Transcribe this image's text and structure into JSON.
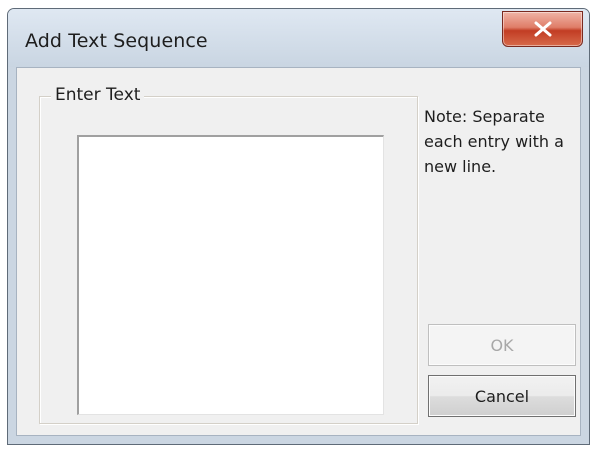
{
  "window": {
    "title": "Add Text Sequence",
    "close_icon": "close-x-icon"
  },
  "group": {
    "label": "Enter Text"
  },
  "text_input": {
    "value": ""
  },
  "note": {
    "text": "Note: Separate each entry with a new line."
  },
  "buttons": {
    "ok_label": "OK",
    "ok_enabled": false,
    "cancel_label": "Cancel"
  },
  "colors": {
    "close_button": "#c8452c",
    "frame": "#cbd6e2",
    "client": "#f0f0f0"
  }
}
